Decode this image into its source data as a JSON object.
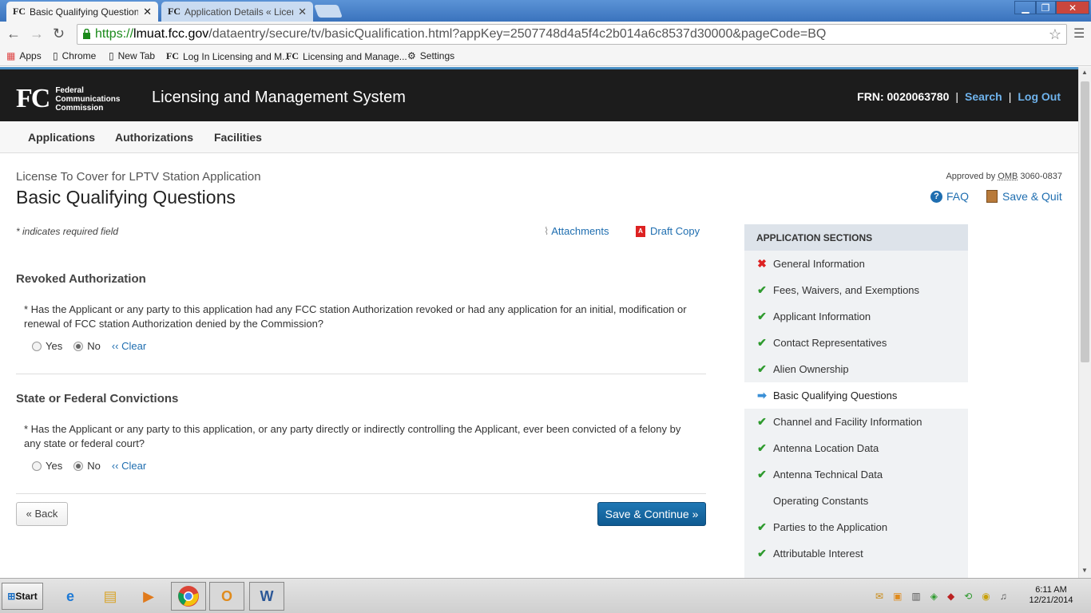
{
  "browser": {
    "tabs": [
      {
        "label": "Basic Qualifying Questions «",
        "active": true
      },
      {
        "label": "Application Details « Licensin",
        "active": false
      }
    ],
    "url": {
      "scheme": "https://",
      "host": "lmuat.fcc.gov",
      "path": "/dataentry/secure/tv/basicQualification.html?appKey=2507748d4a5f4c2b014a6c8537d30000&pageCode=BQ"
    },
    "bookmarks": [
      "Apps",
      "Chrome",
      "New Tab",
      "Log In Licensing and M...",
      "Licensing and Manage...",
      "Settings"
    ]
  },
  "header": {
    "logo_mark": "FC",
    "agency_line1": "Federal",
    "agency_line2": "Communications",
    "agency_line3": "Commission",
    "system_title": "Licensing and Management System",
    "frn": "FRN: 0020063780",
    "search": "Search",
    "logout": "Log Out",
    "separator": "|"
  },
  "nav": [
    "Applications",
    "Authorizations",
    "Facilities"
  ],
  "page": {
    "subtitle": "License To Cover for LPTV Station Application",
    "title": "Basic Qualifying Questions",
    "omb_prefix": "Approved by",
    "omb_abbr": "OMB",
    "omb_num": "3060-0837",
    "faq": "FAQ",
    "save_quit": "Save & Quit",
    "required_note": "* indicates required field",
    "attachments": "Attachments",
    "draft_copy": "Draft Copy"
  },
  "questions": [
    {
      "section": "Revoked Authorization",
      "text": "* Has the Applicant or any party to this application had any FCC station Authorization revoked or had any application for an initial, modification or renewal of FCC station Authorization denied by the Commission?",
      "yes": "Yes",
      "no": "No",
      "selected": "No",
      "clear": "‹‹ Clear"
    },
    {
      "section": "State or Federal Convictions",
      "text": "* Has the Applicant or any party to this application, or any party directly or indirectly controlling the Applicant, ever been convicted of a felony by any state or federal court?",
      "yes": "Yes",
      "no": "No",
      "selected": "No",
      "clear": "‹‹ Clear"
    }
  ],
  "buttons": {
    "back": "« Back",
    "save_continue": "Save & Continue »"
  },
  "sections": {
    "heading": "APPLICATION SECTIONS",
    "items": [
      {
        "label": "General Information",
        "status": "error"
      },
      {
        "label": "Fees, Waivers, and Exemptions",
        "status": "complete"
      },
      {
        "label": "Applicant Information",
        "status": "complete"
      },
      {
        "label": "Contact Representatives",
        "status": "complete"
      },
      {
        "label": "Alien Ownership",
        "status": "complete"
      },
      {
        "label": "Basic Qualifying Questions",
        "status": "current"
      },
      {
        "label": "Channel and Facility Information",
        "status": "complete"
      },
      {
        "label": "Antenna Location Data",
        "status": "complete"
      },
      {
        "label": "Antenna Technical Data",
        "status": "complete"
      },
      {
        "label": "Operating Constants",
        "status": "none"
      },
      {
        "label": "Parties to the Application",
        "status": "complete"
      },
      {
        "label": "Attributable Interest",
        "status": "complete"
      }
    ]
  },
  "taskbar": {
    "start": "Start",
    "time": "6:11 AM",
    "date": "12/21/2014"
  },
  "colors": {
    "link": "#1f6eb0",
    "header_bg": "#1c1c1c",
    "primary_button": "#0f5a91",
    "check": "#2e9a2e",
    "error": "#dd2222"
  }
}
